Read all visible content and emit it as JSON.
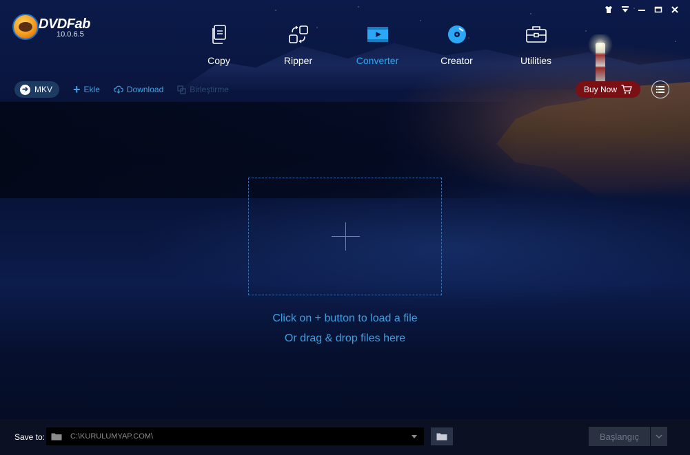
{
  "app": {
    "name": "DVDFab",
    "version": "10.0.6.5"
  },
  "window_controls": [
    "shirt-icon",
    "dropdown-icon",
    "minimize-icon",
    "maximize-icon",
    "close-icon"
  ],
  "nav": {
    "tabs": [
      {
        "label": "Copy",
        "icon": "copy-icon",
        "active": false
      },
      {
        "label": "Ripper",
        "icon": "ripper-icon",
        "active": false
      },
      {
        "label": "Converter",
        "icon": "converter-icon",
        "active": true
      },
      {
        "label": "Creator",
        "icon": "creator-icon",
        "active": false
      },
      {
        "label": "Utilities",
        "icon": "utilities-icon",
        "active": false
      }
    ]
  },
  "toolbar": {
    "profile_label": "MKV",
    "add_label": "Ekle",
    "download_label": "Download",
    "merge_label": "Birleştirme",
    "buy_now_label": "Buy Now"
  },
  "dropzone": {
    "line1": "Click on + button to load a file",
    "line2": "Or drag & drop files here"
  },
  "bottom": {
    "save_to_label": "Save to:",
    "save_path": "C:\\KURULUMYAP.COM\\",
    "start_label": "Başlangıç"
  },
  "colors": {
    "accent": "#2aa8f5",
    "buy_now": "#7a1014",
    "disabled": "#2d4b72"
  }
}
